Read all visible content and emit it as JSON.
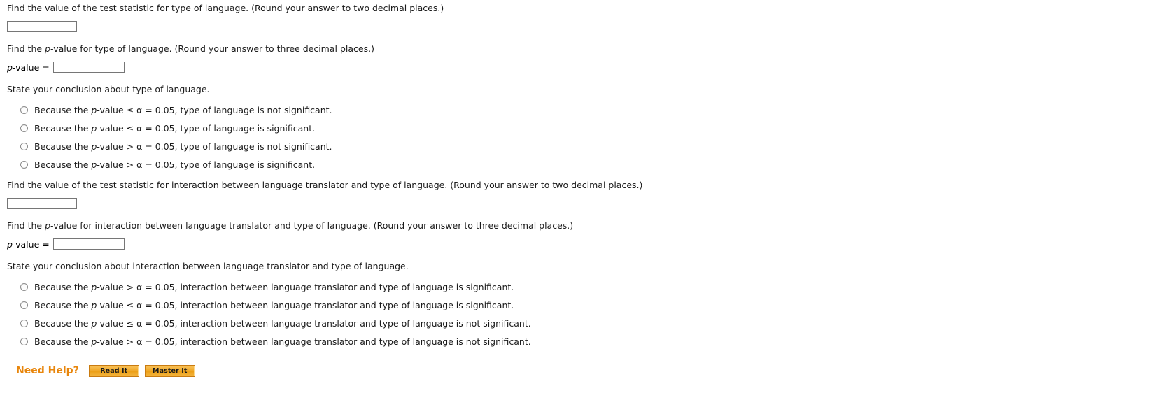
{
  "questions": {
    "q1": {
      "prompt_pre": "Find the value of the test statistic for type of language. (Round your answer to two decimal places.)",
      "input_value": "",
      "input_placeholder": ""
    },
    "q2": {
      "prompt_a": "Find the ",
      "prompt_italic": "p",
      "prompt_b": "-value for type of language. (Round your answer to three decimal places.)",
      "answer_label_italic": "p",
      "answer_label_rest": "-value =",
      "input_value": "",
      "input_placeholder": ""
    },
    "q3": {
      "prompt": "State your conclusion about type of language.",
      "options": [
        {
          "pre": "Because the ",
          "italic": "p",
          "post": "-value ≤ α = 0.05, type of language is not significant."
        },
        {
          "pre": "Because the ",
          "italic": "p",
          "post": "-value ≤ α = 0.05, type of language is significant."
        },
        {
          "pre": "Because the ",
          "italic": "p",
          "post": "-value > α = 0.05, type of language is not significant."
        },
        {
          "pre": "Because the ",
          "italic": "p",
          "post": "-value > α = 0.05, type of language is significant."
        }
      ]
    },
    "q4": {
      "prompt_pre": "Find the value of the test statistic for interaction between language translator and type of language. (Round your answer to two decimal places.)",
      "input_value": "",
      "input_placeholder": ""
    },
    "q5": {
      "prompt_a": "Find the ",
      "prompt_italic": "p",
      "prompt_b": "-value for interaction between language translator and type of language. (Round your answer to three decimal places.)",
      "answer_label_italic": "p",
      "answer_label_rest": "-value =",
      "input_value": "",
      "input_placeholder": ""
    },
    "q6": {
      "prompt": "State your conclusion about interaction between language translator and type of language.",
      "options": [
        {
          "pre": "Because the ",
          "italic": "p",
          "post": "-value > α = 0.05, interaction between language translator and type of language is significant."
        },
        {
          "pre": "Because the ",
          "italic": "p",
          "post": "-value ≤ α = 0.05, interaction between language translator and type of language is significant."
        },
        {
          "pre": "Because the ",
          "italic": "p",
          "post": "-value ≤ α = 0.05, interaction between language translator and type of language is not significant."
        },
        {
          "pre": "Because the ",
          "italic": "p",
          "post": "-value > α = 0.05, interaction between language translator and type of language is not significant."
        }
      ]
    }
  },
  "help": {
    "title": "Need Help?",
    "read_it_label": "Read It",
    "master_it_label": "Master It",
    "accent_color": "#E8860C"
  }
}
